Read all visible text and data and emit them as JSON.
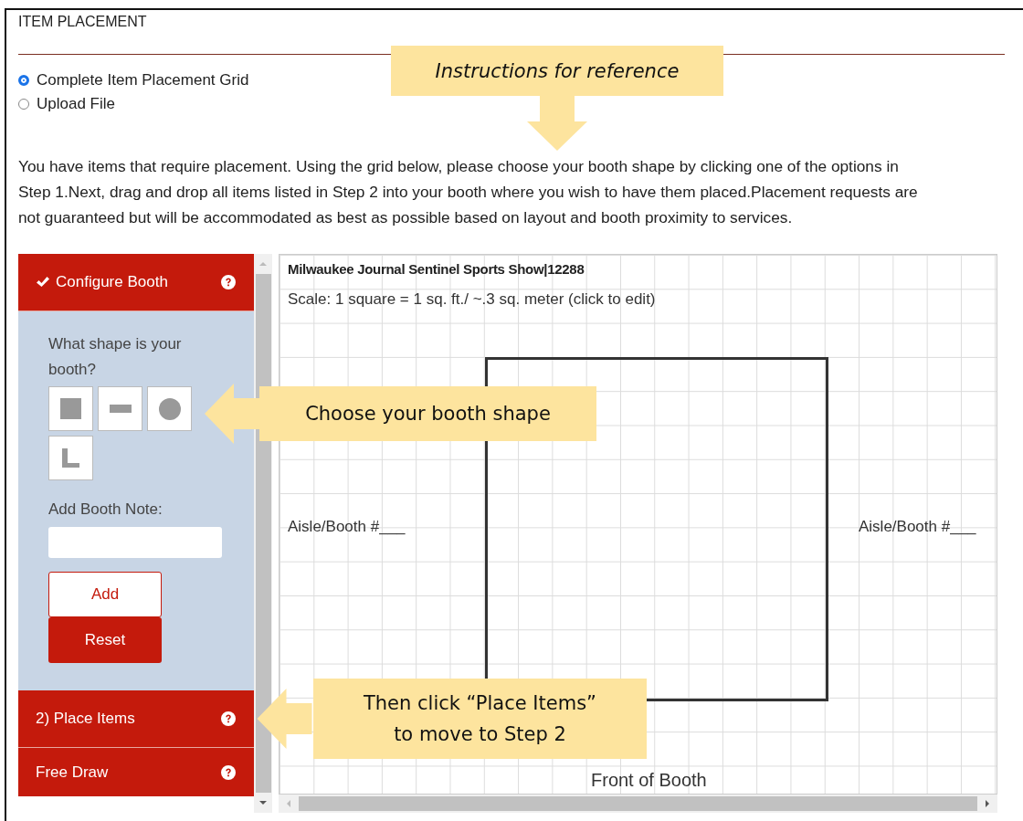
{
  "section_title": "ITEM PLACEMENT",
  "options": [
    {
      "label": "Complete Item Placement Grid",
      "selected": true
    },
    {
      "label": "Upload File",
      "selected": false
    }
  ],
  "instructions": "You have items that require placement. Using the grid below, please choose your booth shape by clicking one of the options in Step 1.Next, drag and drop all items listed in Step 2 into your booth where you wish to have them placed.Placement requests are not guaranteed but will be accommodated as best as possible based on layout and booth proximity to services.",
  "panels": [
    {
      "title": "Configure Booth",
      "checked": true,
      "expanded": true
    },
    {
      "title": "2) Place Items",
      "checked": false,
      "expanded": false
    },
    {
      "title": "Free Draw",
      "checked": false,
      "expanded": false
    }
  ],
  "configure": {
    "prompt": "What shape is your booth?",
    "shapes": [
      {
        "kind": "square"
      },
      {
        "kind": "rectangle"
      },
      {
        "kind": "circle"
      },
      {
        "kind": "l-shape"
      }
    ],
    "note_label": "Add Booth Note:",
    "buttons": [
      {
        "label": "Add",
        "kind": "outline"
      },
      {
        "label": "Reset",
        "kind": "solid"
      }
    ]
  },
  "canvas": {
    "title": "Milwaukee Journal Sentinel Sports Show|12288",
    "scale": "Scale: 1 square = 1 sq. ft./ ~.3 sq. meter (click to edit)",
    "aisle_left": "Aisle/Booth #___",
    "aisle_right": "Aisle/Booth #___",
    "front": "Front of Booth"
  },
  "callouts": [
    {
      "text": "Instructions for reference",
      "italic": true,
      "kind": "down"
    },
    {
      "text": "Choose your booth shape",
      "italic": false,
      "kind": "left"
    },
    {
      "text": "Then click “Place Items”\nto move to Step 2",
      "italic": false,
      "kind": "left"
    }
  ]
}
